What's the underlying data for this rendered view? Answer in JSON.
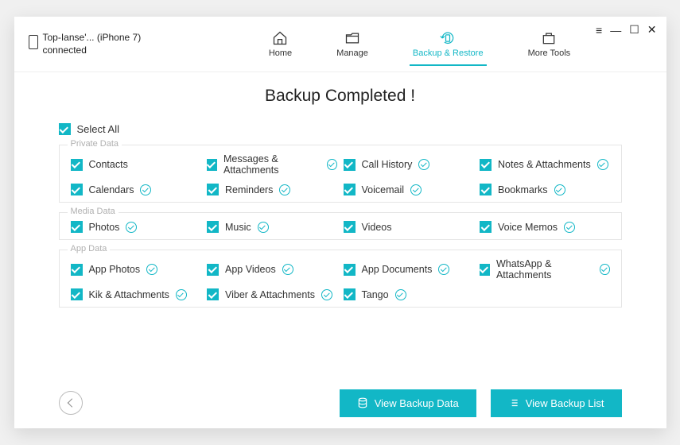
{
  "device": {
    "name": "Top-Ianse'... (iPhone 7)",
    "status": "connected"
  },
  "nav": {
    "home": "Home",
    "manage": "Manage",
    "backup": "Backup & Restore",
    "tools": "More Tools"
  },
  "title": "Backup Completed !",
  "select_all": "Select All",
  "groups": {
    "private": {
      "label": "Private Data",
      "items": [
        {
          "label": "Contacts",
          "status": false
        },
        {
          "label": "Messages & Attachments",
          "status": true
        },
        {
          "label": "Call History",
          "status": true
        },
        {
          "label": "Notes & Attachments",
          "status": true
        },
        {
          "label": "Calendars",
          "status": true
        },
        {
          "label": "Reminders",
          "status": true
        },
        {
          "label": "Voicemail",
          "status": true
        },
        {
          "label": "Bookmarks",
          "status": true
        }
      ]
    },
    "media": {
      "label": "Media Data",
      "items": [
        {
          "label": "Photos",
          "status": true
        },
        {
          "label": "Music",
          "status": true
        },
        {
          "label": "Videos",
          "status": false
        },
        {
          "label": "Voice Memos",
          "status": true
        }
      ]
    },
    "app": {
      "label": "App Data",
      "items": [
        {
          "label": "App Photos",
          "status": true
        },
        {
          "label": "App Videos",
          "status": true
        },
        {
          "label": "App Documents",
          "status": true
        },
        {
          "label": "WhatsApp & Attachments",
          "status": true
        },
        {
          "label": "Kik & Attachments",
          "status": true
        },
        {
          "label": "Viber & Attachments",
          "status": true
        },
        {
          "label": "Tango",
          "status": true
        }
      ]
    }
  },
  "buttons": {
    "view_data": "View Backup Data",
    "view_list": "View Backup List"
  }
}
